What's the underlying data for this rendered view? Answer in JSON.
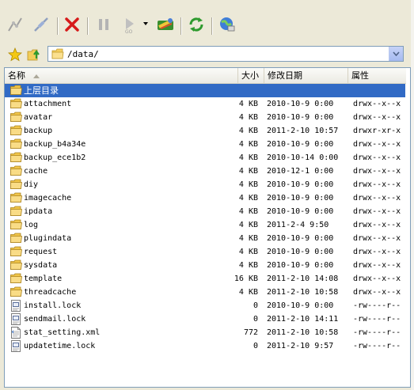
{
  "toolbar": {
    "buttons": [
      {
        "icon": "connect-icon",
        "enabled": false
      },
      {
        "icon": "disconnect-icon",
        "enabled": false
      },
      {
        "icon": "cancel-x-icon",
        "enabled": true
      },
      {
        "icon": "pause-icon",
        "enabled": false
      },
      {
        "icon": "play-go-icon",
        "enabled": false
      },
      {
        "icon": "transfer-queue-icon",
        "enabled": true
      },
      {
        "icon": "refresh-icon",
        "enabled": true
      },
      {
        "icon": "globe-network-icon",
        "enabled": true
      }
    ]
  },
  "address": {
    "path": "/data/"
  },
  "columns": {
    "name": "名称",
    "size": "大小",
    "date": "修改日期",
    "attr": "属性"
  },
  "parent_row": {
    "label": "上层目录"
  },
  "files": [
    {
      "name": "attachment",
      "type": "folder",
      "size": "4 KB",
      "date": "2010-10-9 0:00",
      "attr": "drwx--x--x"
    },
    {
      "name": "avatar",
      "type": "folder",
      "size": "4 KB",
      "date": "2010-10-9 0:00",
      "attr": "drwx--x--x"
    },
    {
      "name": "backup",
      "type": "folder",
      "size": "4 KB",
      "date": "2011-2-10 10:57",
      "attr": "drwxr-xr-x"
    },
    {
      "name": "backup_b4a34e",
      "type": "folder",
      "size": "4 KB",
      "date": "2010-10-9 0:00",
      "attr": "drwx--x--x"
    },
    {
      "name": "backup_ece1b2",
      "type": "folder",
      "size": "4 KB",
      "date": "2010-10-14 0:00",
      "attr": "drwx--x--x"
    },
    {
      "name": "cache",
      "type": "folder",
      "size": "4 KB",
      "date": "2010-12-1 0:00",
      "attr": "drwx--x--x"
    },
    {
      "name": "diy",
      "type": "folder",
      "size": "4 KB",
      "date": "2010-10-9 0:00",
      "attr": "drwx--x--x"
    },
    {
      "name": "imagecache",
      "type": "folder",
      "size": "4 KB",
      "date": "2010-10-9 0:00",
      "attr": "drwx--x--x"
    },
    {
      "name": "ipdata",
      "type": "folder",
      "size": "4 KB",
      "date": "2010-10-9 0:00",
      "attr": "drwx--x--x"
    },
    {
      "name": "log",
      "type": "folder",
      "size": "4 KB",
      "date": "2011-2-4 9:50",
      "attr": "drwx--x--x"
    },
    {
      "name": "plugindata",
      "type": "folder",
      "size": "4 KB",
      "date": "2010-10-9 0:00",
      "attr": "drwx--x--x"
    },
    {
      "name": "request",
      "type": "folder",
      "size": "4 KB",
      "date": "2010-10-9 0:00",
      "attr": "drwx--x--x"
    },
    {
      "name": "sysdata",
      "type": "folder",
      "size": "4 KB",
      "date": "2010-10-9 0:00",
      "attr": "drwx--x--x"
    },
    {
      "name": "template",
      "type": "folder",
      "size": "16 KB",
      "date": "2011-2-10 14:08",
      "attr": "drwx--x--x"
    },
    {
      "name": "threadcache",
      "type": "folder",
      "size": "4 KB",
      "date": "2011-2-10 10:58",
      "attr": "drwx--x--x"
    },
    {
      "name": "install.lock",
      "type": "lock",
      "size": "0",
      "date": "2010-10-9 0:00",
      "attr": "-rw----r--"
    },
    {
      "name": "sendmail.lock",
      "type": "lock",
      "size": "0",
      "date": "2011-2-10 14:11",
      "attr": "-rw----r--"
    },
    {
      "name": "stat_setting.xml",
      "type": "xml",
      "size": "772",
      "date": "2011-2-10 10:58",
      "attr": "-rw----r--"
    },
    {
      "name": "updatetime.lock",
      "type": "lock",
      "size": "0",
      "date": "2011-2-10 9:57",
      "attr": "-rw----r--"
    }
  ],
  "colors": {
    "selection": "#316ac5",
    "folder": "#f5cf5f",
    "window_bg": "#ece9d8"
  }
}
